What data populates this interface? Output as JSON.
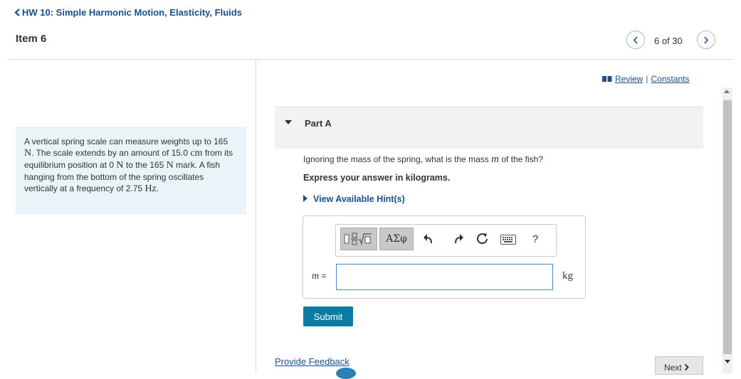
{
  "header": {
    "back_label": "HW 10: Simple Harmonic Motion, Elasticity, Fluids",
    "item_title": "Item 6",
    "pager": "6 of 30"
  },
  "problem": {
    "t1": "A vertical spring scale can measure weights up to 165 ",
    "u1": "N",
    "t2": ". The scale extends by an amount of 15.0 ",
    "u2": "cm",
    "t3": " from its equilibrium position at 0 ",
    "u3": "N",
    "t4": " to the 165 ",
    "u4": "N",
    "t5": " mark. A fish hanging from the bottom of the spring oscillates vertically at a frequency of 2.75 ",
    "u5": "Hz",
    "t6": "."
  },
  "links": {
    "review": "Review",
    "separator": "|",
    "constants": "Constants"
  },
  "part": {
    "title": "Part A",
    "question_pre": "Ignoring the mass of the spring, what is the mass ",
    "question_var": "m",
    "question_post": " of the fish?",
    "instruction": "Express your answer in kilograms.",
    "hints": "View Available Hint(s)"
  },
  "answer": {
    "greek_label": "ΑΣφ",
    "help_label": "?",
    "var_name": "m",
    "equals": " =",
    "value": "",
    "unit": "kg",
    "submit_label": "Submit"
  },
  "footer": {
    "feedback": "Provide Feedback",
    "next_label": "Next"
  },
  "colors": {
    "accent_link": "#1a4f8b",
    "submit_bg": "#0a7ba3",
    "problem_bg": "#e8f4f8"
  }
}
